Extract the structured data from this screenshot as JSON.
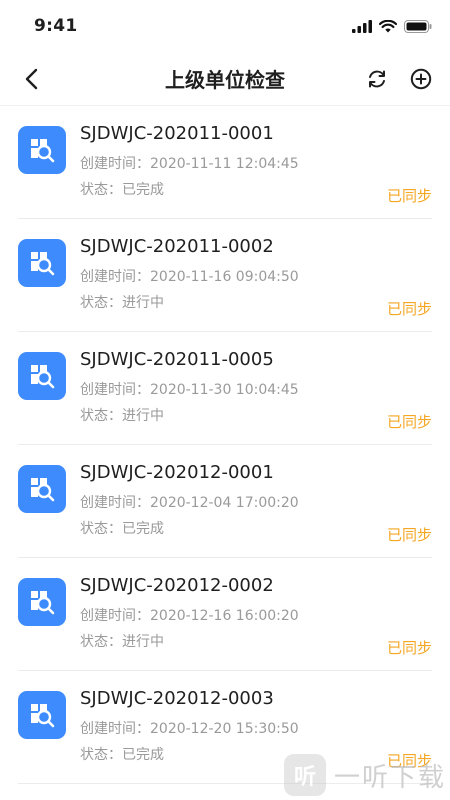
{
  "status_bar": {
    "time": "9:41"
  },
  "header": {
    "title": "上级单位检查"
  },
  "items": [
    {
      "code": "SJDWJC-202011-0001",
      "created": "创建时间：2020-11-11 12:04:45",
      "status": "状态：已完成",
      "sync": "已同步"
    },
    {
      "code": "SJDWJC-202011-0002",
      "created": "创建时间：2020-11-16 09:04:50",
      "status": "状态：进行中",
      "sync": "已同步"
    },
    {
      "code": "SJDWJC-202011-0005",
      "created": "创建时间：2020-11-30 10:04:45",
      "status": "状态：进行中",
      "sync": "已同步"
    },
    {
      "code": "SJDWJC-202012-0001",
      "created": "创建时间：2020-12-04 17:00:20",
      "status": "状态：已完成",
      "sync": "已同步"
    },
    {
      "code": "SJDWJC-202012-0002",
      "created": "创建时间：2020-12-16 16:00:20",
      "status": "状态：进行中",
      "sync": "已同步"
    },
    {
      "code": "SJDWJC-202012-0003",
      "created": "创建时间：2020-12-20 15:30:50",
      "status": "状态：已完成",
      "sync": "已同步"
    }
  ],
  "watermark": {
    "badge": "听",
    "text": "一听下载"
  },
  "colors": {
    "accent": "#3d8bfd",
    "sync": "#f5a623",
    "muted": "#9a9a9a"
  }
}
